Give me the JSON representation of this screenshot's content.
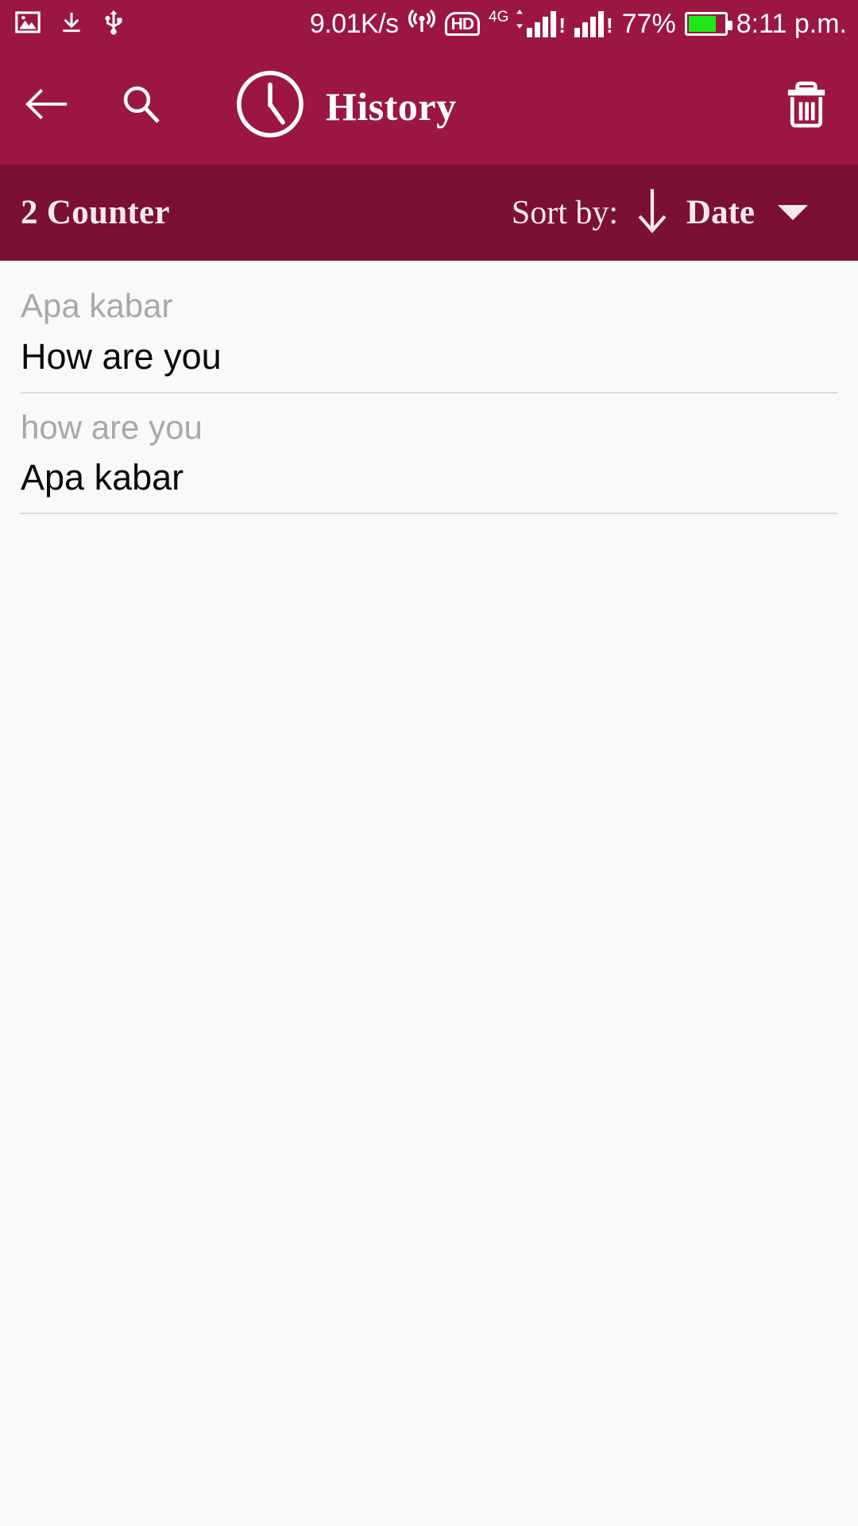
{
  "colors": {
    "app_bar": "#9B1742",
    "sort_bar": "#7A1133",
    "page_background": "#F9F9F9",
    "battery_fill": "#1DE815",
    "source_text": "#A8A8A8",
    "target_text": "#0A0A0A",
    "divider": "#DCDCDC"
  },
  "status_bar": {
    "left_icons": [
      "image-icon",
      "download-icon",
      "usb-icon"
    ],
    "network_speed": "9.01K/s",
    "hotspot_icon": "hotspot-icon",
    "hd_badge": "HD",
    "network_generation": "4G",
    "sim1_signal": "signal-bars-icon",
    "sim1_alert": "!",
    "sim2_signal": "signal-bars-icon",
    "sim2_alert": "!",
    "battery_percent": "77%",
    "battery_level": 77,
    "time": "8:11 p.m."
  },
  "app_bar": {
    "back_label": "back-arrow",
    "search_label": "search",
    "clock_icon": "clock-icon",
    "title": "History",
    "delete_label": "delete-all"
  },
  "sort_bar": {
    "counter": "2 Counter",
    "sort_by_label": "Sort by:",
    "sort_direction": "descending",
    "sort_value": "Date",
    "dropdown": "chevron-down"
  },
  "history": {
    "items": [
      {
        "source": "Apa kabar",
        "target": "How are you"
      },
      {
        "source": "how are you",
        "target": "Apa kabar"
      }
    ]
  }
}
